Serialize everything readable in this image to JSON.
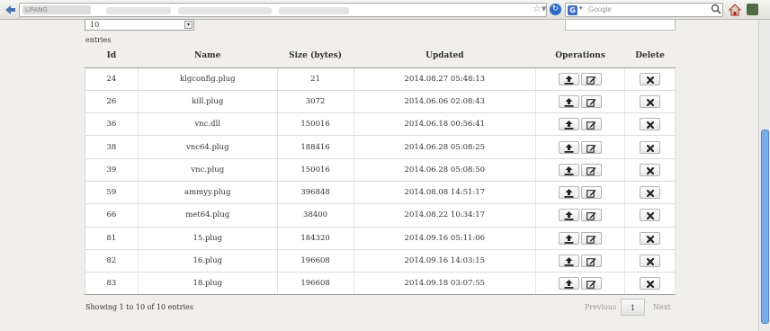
{
  "browser": {
    "site_label": "LIFANG",
    "search_placeholder": "Google",
    "search_engine_glyph": "G",
    "star_glyph": "☆▾",
    "reload_glyph": "↻",
    "caret_glyph": "▾"
  },
  "table_controls": {
    "length_value": "10",
    "select_arrow_glyph": "▾",
    "entries_label": "entries"
  },
  "table": {
    "columns": [
      "Id",
      "Name",
      "Size (bytes)",
      "Updated",
      "Operations",
      "Delete"
    ],
    "rows": [
      {
        "id": "24",
        "name": "klgconfig.plug",
        "size": "21",
        "updated": "2014.08.27 05:48:13"
      },
      {
        "id": "26",
        "name": "kill.plug",
        "size": "3072",
        "updated": "2014.06.06 02:08:43"
      },
      {
        "id": "36",
        "name": "vnc.dll",
        "size": "150016",
        "updated": "2014.06.18 00:56:41"
      },
      {
        "id": "38",
        "name": "vnc64.plug",
        "size": "188416",
        "updated": "2014.06.28 05:08:25"
      },
      {
        "id": "39",
        "name": "vnc.plug",
        "size": "150016",
        "updated": "2014.06.28 05:08:50"
      },
      {
        "id": "59",
        "name": "ammyy.plug",
        "size": "396848",
        "updated": "2014.08.08 14:51:17"
      },
      {
        "id": "66",
        "name": "met64.plug",
        "size": "38400",
        "updated": "2014.08.22 10:34:17"
      },
      {
        "id": "81",
        "name": "15.plug",
        "size": "184320",
        "updated": "2014.09.16 05:11:06"
      },
      {
        "id": "82",
        "name": "16.plug",
        "size": "196608",
        "updated": "2014.09.16 14:03:15"
      },
      {
        "id": "83",
        "name": "18.plug",
        "size": "196608",
        "updated": "2014.09.18 03:07:55"
      }
    ],
    "icons": {
      "upload": "upload-icon",
      "edit": "edit-icon",
      "delete": "delete-x-icon"
    }
  },
  "footer": {
    "info": "Showing 1 to 10 of 10 entries",
    "previous": "Previous",
    "current_page": "1",
    "next": "Next"
  },
  "colors": {
    "page_bg": "#f1efeb",
    "scroll_thumb": "#7aaee8",
    "reload": "#2a6ac4"
  }
}
